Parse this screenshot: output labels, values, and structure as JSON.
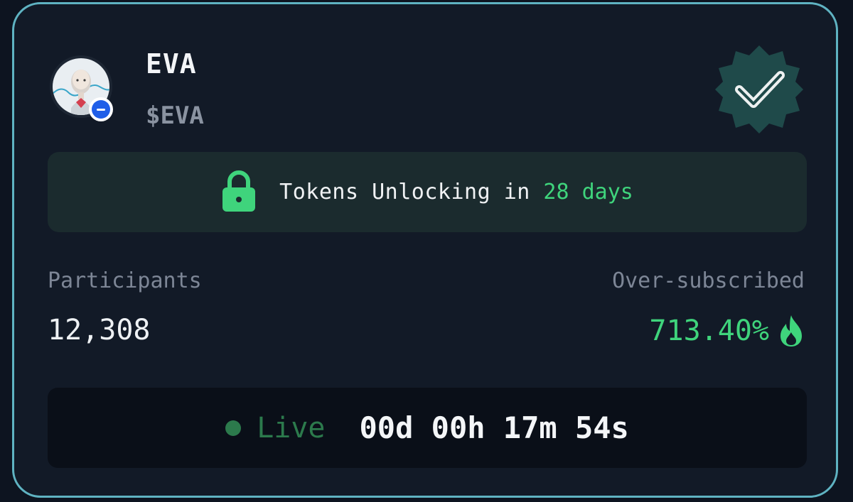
{
  "token": {
    "name": "EVA",
    "symbol": "$EVA"
  },
  "unlock": {
    "prefix": "Tokens Unlocking in ",
    "days": "28 days"
  },
  "stats": {
    "participants_label": "Participants",
    "participants_value": "12,308",
    "oversubscribed_label": "Over-subscribed",
    "oversubscribed_value": "713.40%"
  },
  "live": {
    "label": "Live",
    "countdown": "00d 00h 17m 54s"
  },
  "colors": {
    "accent_green": "#3fd47c",
    "card_border": "#5fb3c2",
    "card_bg": "#121a27"
  },
  "icons": {
    "avatar": "ai-robot-avatar",
    "chain": "chain-badge-icon",
    "verified": "verified-badge-icon",
    "lock": "lock-icon",
    "fire": "fire-icon",
    "live": "live-dot-icon"
  }
}
